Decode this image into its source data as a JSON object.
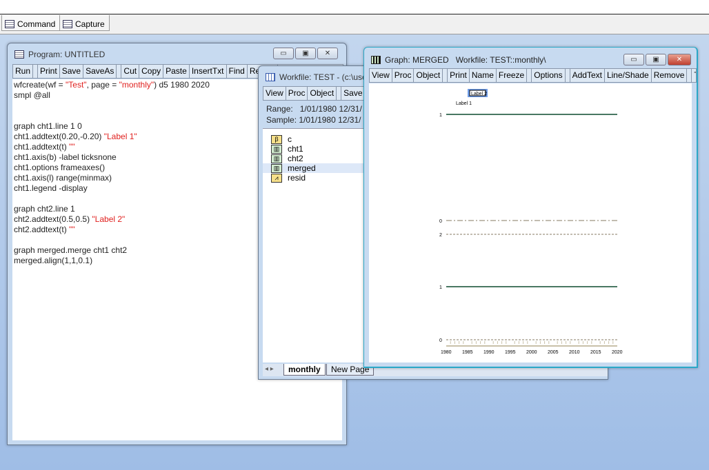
{
  "command_tabs": [
    {
      "label": "Command",
      "icon": "document-icon"
    },
    {
      "label": "Capture",
      "icon": "document-icon"
    }
  ],
  "program": {
    "title": "Program: UNTITLED",
    "toolbar": [
      "Run",
      "Print",
      "Save",
      "SaveAs",
      "Cut",
      "Copy",
      "Paste",
      "InsertTxt",
      "Find",
      "Replac"
    ],
    "lines": [
      [
        {
          "t": "wfcreate(wf = "
        },
        {
          "t": "\"Test\"",
          "s": 1
        },
        {
          "t": ", page = "
        },
        {
          "t": "\"monthly\"",
          "s": 1
        },
        {
          "t": ") d5 1980 2020"
        }
      ],
      [
        {
          "t": "smpl @all"
        }
      ],
      [],
      [],
      [
        {
          "t": "graph cht1.line 1 0"
        }
      ],
      [
        {
          "t": "cht1.addtext(0.20,-0.20) "
        },
        {
          "t": "\"Label 1\"",
          "s": 1
        }
      ],
      [
        {
          "t": "cht1.addtext(t) "
        },
        {
          "t": "\"\"",
          "s": 1
        }
      ],
      [
        {
          "t": "cht1.axis(b) -label ticksnone"
        }
      ],
      [
        {
          "t": "cht1.options frameaxes()"
        }
      ],
      [
        {
          "t": "cht1.axis(l) range(minmax)"
        }
      ],
      [
        {
          "t": "cht1.legend -display"
        }
      ],
      [],
      [
        {
          "t": "graph cht2.line 1"
        }
      ],
      [
        {
          "t": "cht2.addtext(0.5,0.5) "
        },
        {
          "t": "\"Label 2\"",
          "s": 1
        }
      ],
      [
        {
          "t": "cht2.addtext(t) "
        },
        {
          "t": "\"\"",
          "s": 1
        }
      ],
      [],
      [
        {
          "t": "graph merged.merge cht1 cht2"
        }
      ],
      [
        {
          "t": "merged.align(1,1,0.1)"
        }
      ]
    ]
  },
  "workfile": {
    "title": "Workfile: TEST - (c:\\use",
    "toolbar": [
      "View",
      "Proc",
      "Object",
      "Save"
    ],
    "range_label": "Range:",
    "range_value": "1/01/1980 12/31/",
    "sample_label": "Sample:",
    "sample_value": "1/01/1980 12/31/",
    "objects": [
      {
        "name": "c",
        "icon": "coefficient-icon"
      },
      {
        "name": "cht1",
        "icon": "graph-icon"
      },
      {
        "name": "cht2",
        "icon": "graph-icon"
      },
      {
        "name": "merged",
        "icon": "graph-icon",
        "selected": true
      },
      {
        "name": "resid",
        "icon": "series-icon"
      }
    ],
    "page_tabs": [
      "monthly",
      "New Page"
    ]
  },
  "graph": {
    "title": "Graph: MERGED   Workfile: TEST::monthly\\",
    "toolbar": [
      "View",
      "Proc",
      "Object",
      "Print",
      "Name",
      "Freeze",
      "Options",
      "AddText",
      "Line/Shade",
      "Remove",
      "Tem"
    ],
    "label2": "Label 2",
    "label1": "Label 1",
    "top_panel": {
      "ticks": [
        "1"
      ],
      "line_value": 1,
      "color": "#0b4a2e"
    },
    "bottom_panel": {
      "ticks": [
        "0",
        "2",
        "1",
        "0"
      ],
      "line_value": 1,
      "color": "#0b4a2e",
      "dash_color": "#857a60"
    },
    "x_labels": [
      "1980",
      "1985",
      "1990",
      "1995",
      "2000",
      "2005",
      "2010",
      "2015",
      "2020"
    ]
  }
}
